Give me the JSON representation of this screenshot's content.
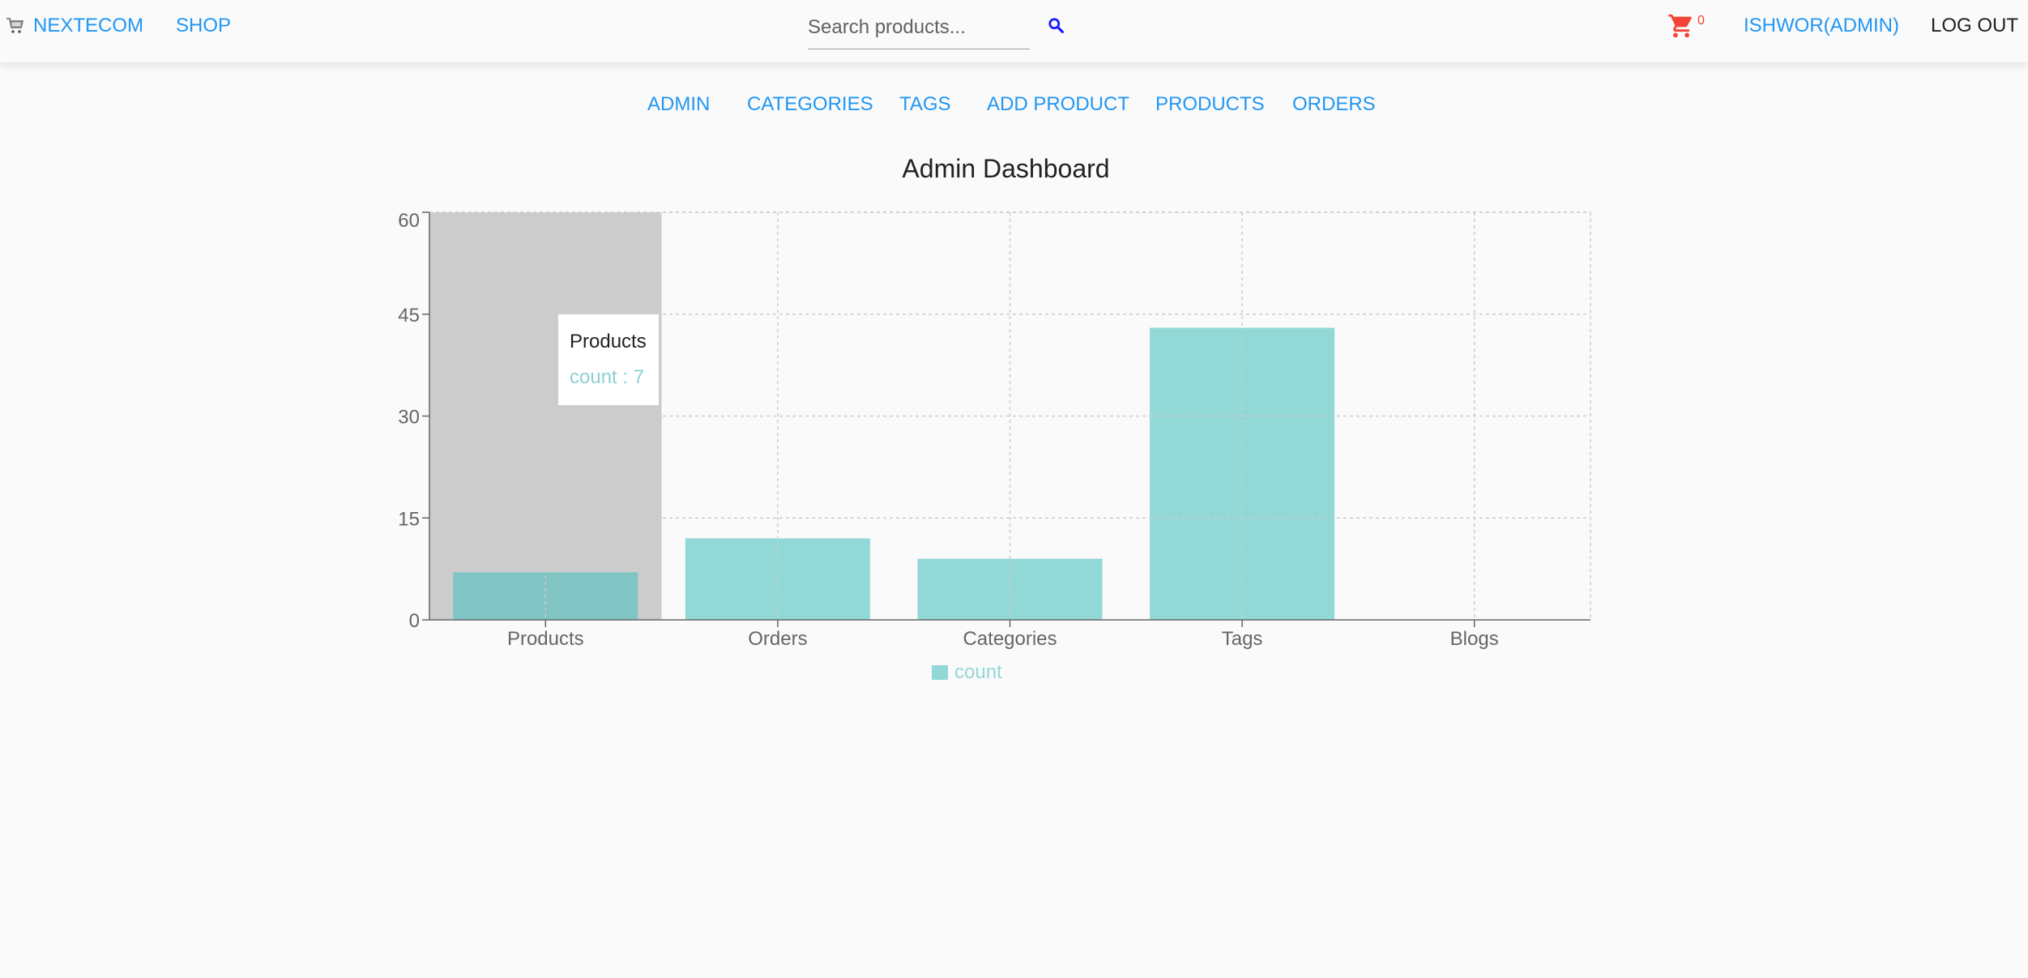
{
  "header": {
    "brand": "NEXTECOM",
    "shop": "SHOP",
    "search_placeholder": "Search products...",
    "cart_count": "0",
    "user": "ISHWOR(ADMIN)",
    "logout": "LOG OUT"
  },
  "nav": {
    "items": [
      {
        "label": "ADMIN"
      },
      {
        "label": "CATEGORIES"
      },
      {
        "label": "TAGS"
      },
      {
        "label": "ADD PRODUCT"
      },
      {
        "label": "PRODUCTS"
      },
      {
        "label": "ORDERS"
      }
    ]
  },
  "page_title": "Admin Dashboard",
  "tooltip": {
    "label": "Products",
    "value": "count : 7"
  },
  "colors": {
    "accent": "#2196f3",
    "bar": "#91d8d7",
    "bar_active": "#80c5c4",
    "cart": "#f44336",
    "hover_bg": "#cccccc"
  },
  "chart_data": {
    "type": "bar",
    "categories": [
      "Products",
      "Orders",
      "Categories",
      "Tags",
      "Blogs"
    ],
    "series": [
      {
        "name": "count",
        "values": [
          7,
          12,
          9,
          43,
          0
        ]
      }
    ],
    "yticks": [
      "0",
      "15",
      "30",
      "45",
      "60"
    ],
    "ylim": [
      0,
      60
    ],
    "grid": true,
    "legend": "bottom-center",
    "highlighted_category": "Products"
  }
}
